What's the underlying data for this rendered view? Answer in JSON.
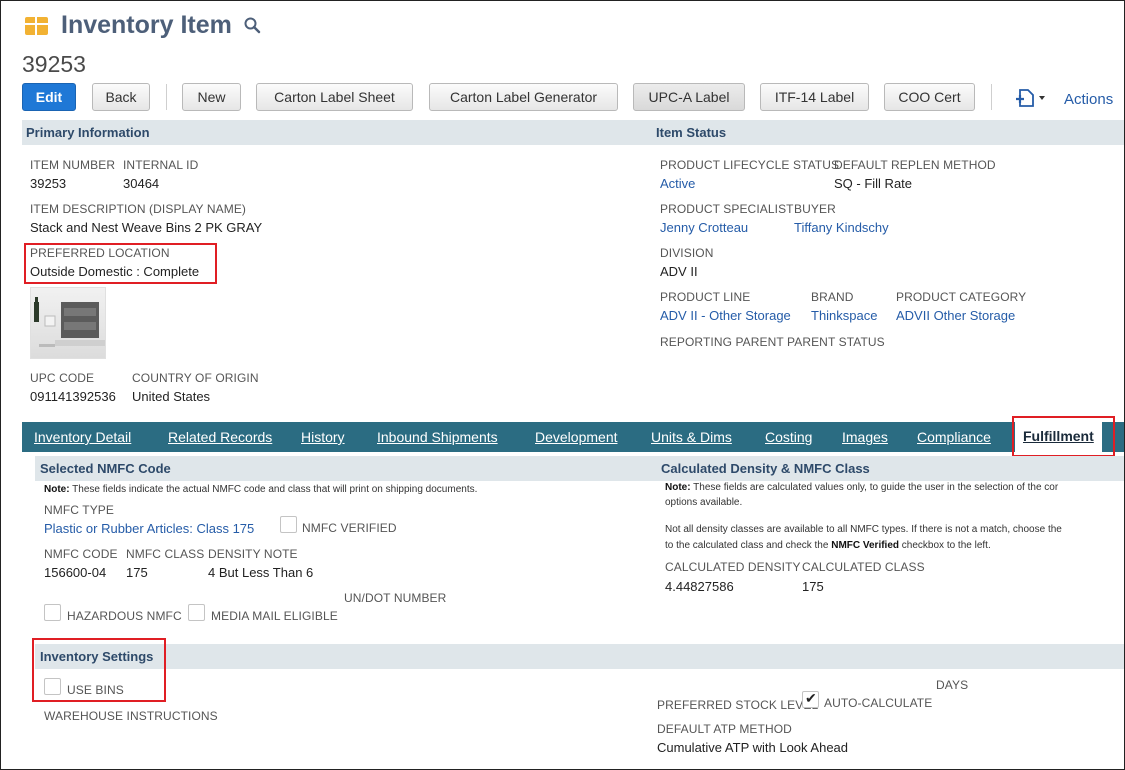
{
  "page": {
    "title": "Inventory Item",
    "record_id": "39253"
  },
  "toolbar": {
    "edit": "Edit",
    "back": "Back",
    "new": "New",
    "carton_label_sheet": "Carton Label Sheet",
    "carton_label_generator": "Carton Label Generator",
    "upc_a_label": "UPC-A Label",
    "itf14_label": "ITF-14 Label",
    "coo_cert": "COO Cert",
    "actions": "Actions"
  },
  "primary": {
    "header": "Primary Information",
    "item_number_label": "ITEM NUMBER",
    "item_number": "39253",
    "internal_id_label": "INTERNAL ID",
    "internal_id": "30464",
    "description_label": "ITEM DESCRIPTION (DISPLAY NAME)",
    "description": "Stack and Nest Weave Bins 2 PK GRAY",
    "preferred_location_label": "PREFERRED LOCATION",
    "preferred_location": "Outside Domestic : Complete",
    "upc_label": "UPC CODE",
    "upc": "091141392536",
    "country_label": "COUNTRY OF ORIGIN",
    "country": "United States"
  },
  "status": {
    "header": "Item Status",
    "lifecycle_label": "PRODUCT LIFECYCLE STATUS",
    "lifecycle": "Active",
    "replen_label": "DEFAULT REPLEN METHOD",
    "replen": "SQ - Fill Rate",
    "specialist_label": "PRODUCT SPECIALIST",
    "specialist": "Jenny Crotteau",
    "buyer_label": "BUYER",
    "buyer": "Tiffany Kindschy",
    "division_label": "DIVISION",
    "division": "ADV II",
    "product_line_label": "PRODUCT LINE",
    "product_line": "ADV II - Other Storage",
    "brand_label": "BRAND",
    "brand": "Thinkspace",
    "category_label": "PRODUCT CATEGORY",
    "category": "ADVII Other Storage",
    "reporting_parent_label": "REPORTING PARENT",
    "parent_status_label": "PARENT STATUS"
  },
  "tabs": [
    {
      "label": "Inventory Detail"
    },
    {
      "label": "Related Records"
    },
    {
      "label": "History"
    },
    {
      "label": "Inbound Shipments"
    },
    {
      "label": "Development"
    },
    {
      "label": "Units & Dims"
    },
    {
      "label": "Costing"
    },
    {
      "label": "Images"
    },
    {
      "label": "Compliance"
    },
    {
      "label": "Fulfillment"
    }
  ],
  "nmfc": {
    "header": "Selected NMFC Code",
    "note_bold": "Note:",
    "note": " These fields indicate the actual NMFC code and class that will print on shipping documents.",
    "type_label": "NMFC TYPE",
    "type": "Plastic or Rubber Articles: Class 175",
    "verified_label": "NMFC VERIFIED",
    "code_label": "NMFC CODE",
    "code": "156600-04",
    "class_label": "NMFC CLASS",
    "class": "175",
    "density_note_label": "DENSITY NOTE",
    "density_note": "4 But Less Than 6",
    "un_dot_label": "UN/DOT NUMBER",
    "hazardous_label": "HAZARDOUS NMFC",
    "media_mail_label": "MEDIA MAIL ELIGIBLE"
  },
  "density": {
    "header": "Calculated Density & NMFC Class",
    "note1_bold": "Note:",
    "note1": " These fields are calculated values only, to guide the user in the selection of the cor",
    "note1b": "options available.",
    "note2": "Not all density classes are available to all NMFC types. If there is not a match, choose the",
    "note3a": "to the calculated class and check the ",
    "note3b": "NMFC Verified",
    "note3c": " checkbox to the left.",
    "calc_density_label": "CALCULATED DENSITY",
    "calc_density": "4.44827586",
    "calc_class_label": "CALCULATED CLASS",
    "calc_class": "175"
  },
  "inventory": {
    "header": "Inventory Settings",
    "use_bins_label": "USE BINS",
    "warehouse_label": "WAREHOUSE INSTRUCTIONS",
    "days_label": "DAYS",
    "stock_level_label": "PREFERRED STOCK LEVEL",
    "auto_calc_label": "AUTO-CALCULATE",
    "atp_label": "DEFAULT ATP METHOD",
    "atp": "Cumulative ATP with Look Ahead"
  }
}
